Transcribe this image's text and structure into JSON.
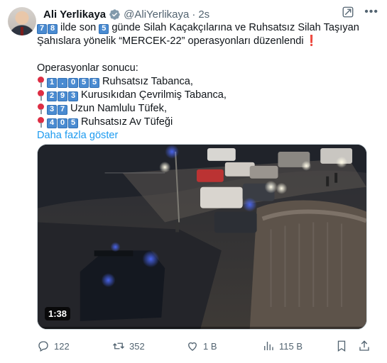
{
  "author": {
    "name": "Ali Yerlikaya",
    "handle": "@AliYerlikaya",
    "separator": "·",
    "time": "2s"
  },
  "tweet": {
    "intro_digits_a": [
      "7",
      "8"
    ],
    "intro_text_a": "ilde son",
    "intro_digits_b": [
      "5"
    ],
    "intro_text_b": "günde Silah Kaçakçılarına ve Ruhsatsız Silah Taşıyan",
    "line2": "Şahıslara yönelik “MERCEK-22” operasyonları düzenlendi",
    "results_heading": "Operasyonlar sonucu:",
    "results": [
      {
        "digits": [
          "1",
          ".",
          "0",
          "5",
          "5"
        ],
        "text": "Ruhsatsız Tabanca,"
      },
      {
        "digits": [
          "2",
          "9",
          "3"
        ],
        "text": "Kurusıkıdan Çevrilmiş Tabanca,"
      },
      {
        "digits": [
          "3",
          "7"
        ],
        "text": "Uzun Namlulu Tüfek,"
      },
      {
        "digits": [
          "4",
          "0",
          "5"
        ],
        "text": "Ruhsatsız Av Tüfeği"
      }
    ],
    "show_more": "Daha fazla göster"
  },
  "media": {
    "duration": "1:38"
  },
  "actions": {
    "replies": "122",
    "reposts": "352",
    "likes": "1 B",
    "views": "115 B"
  },
  "colors": {
    "accent": "#1d9bf0",
    "text": "#0f1419",
    "muted": "#536471",
    "keycap": "#4a8bd1",
    "pin": "#dd2e44"
  }
}
